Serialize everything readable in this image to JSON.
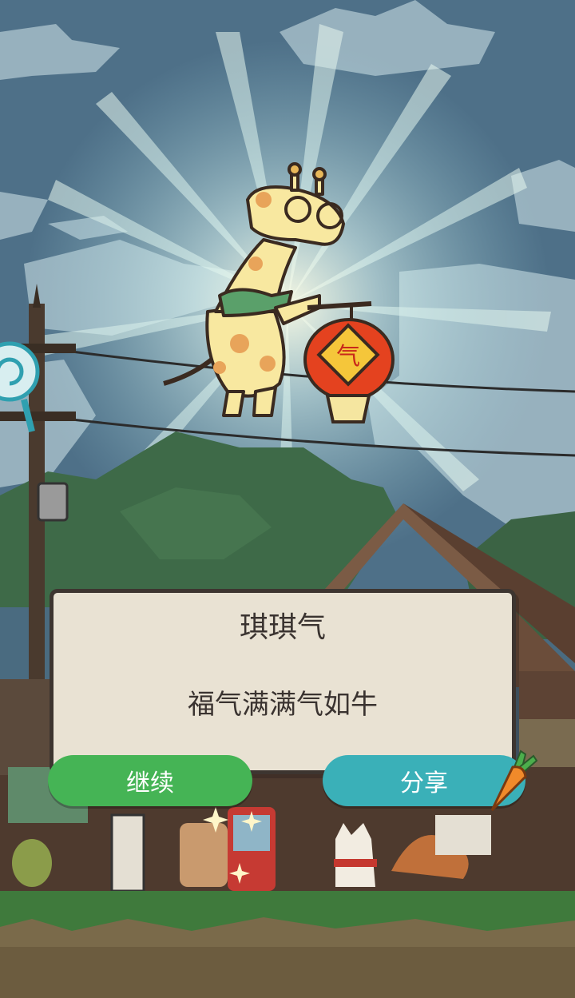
{
  "dialog": {
    "title": "琪琪气",
    "message": "福气满满气如牛"
  },
  "buttons": {
    "continue_label": "继续",
    "share_label": "分享"
  },
  "colors": {
    "sky": "#4e7088",
    "dialog_bg": "#e9e2d3",
    "continue_button": "#45b455",
    "share_button": "#3ab0b8",
    "lantern": "#e4421f"
  },
  "icons": [
    "magnifier-icon",
    "carrot-icon",
    "lantern-icon"
  ]
}
